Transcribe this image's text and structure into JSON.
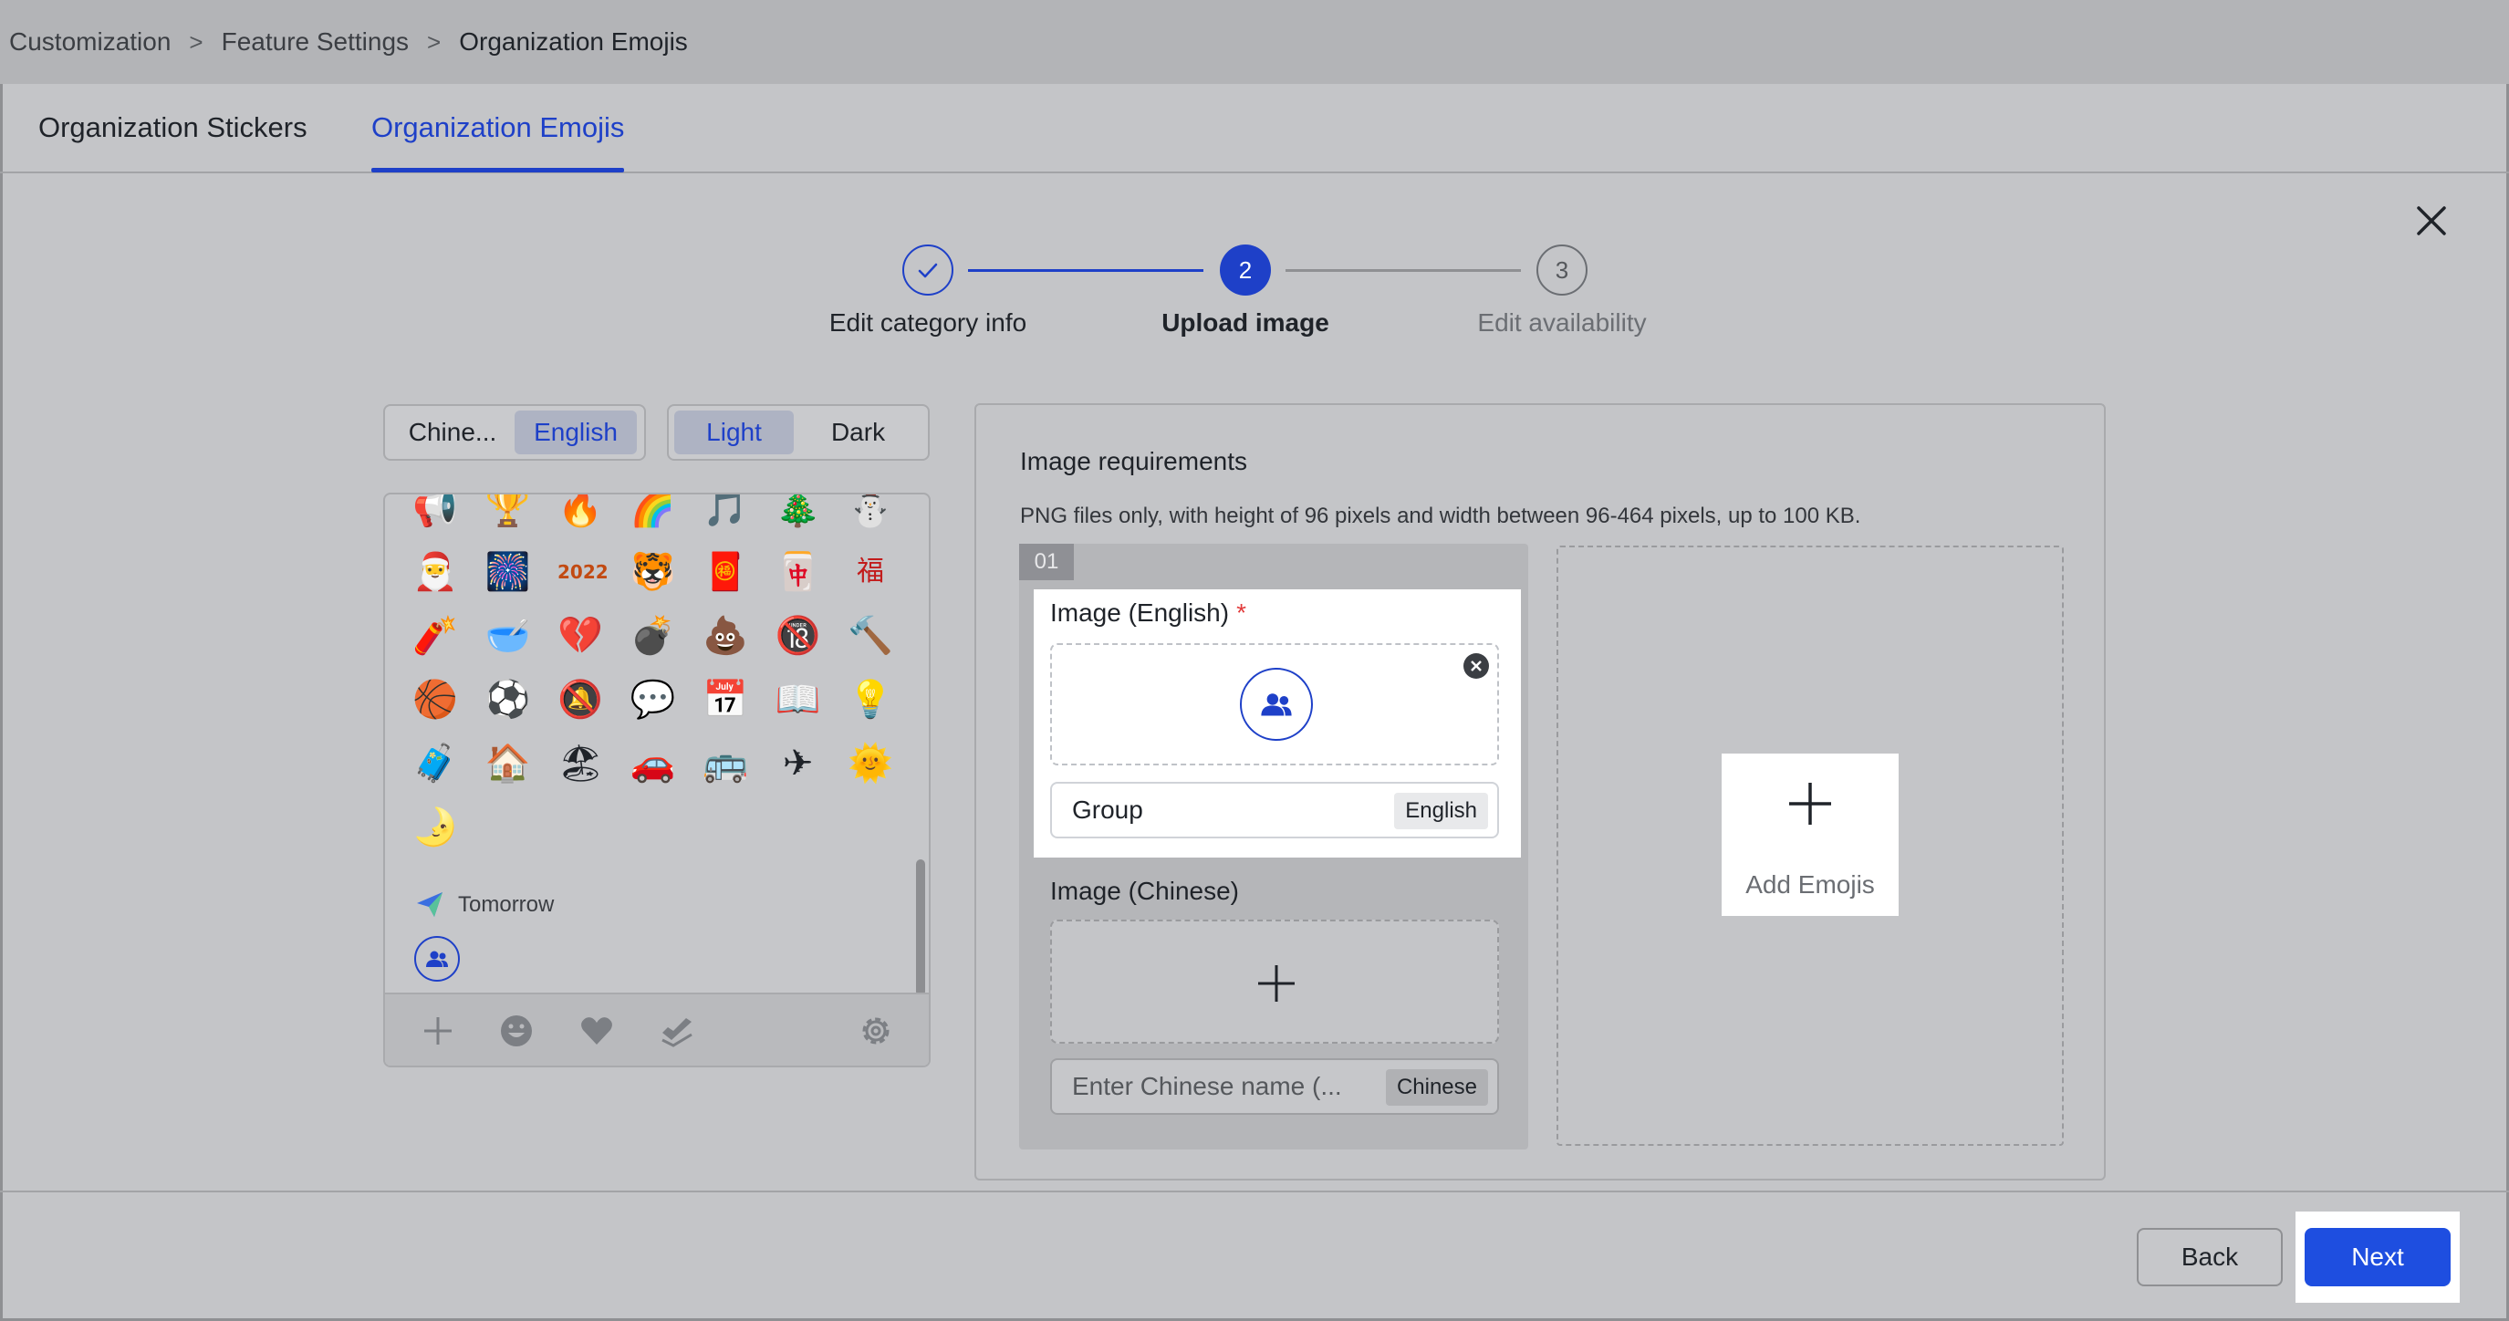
{
  "breadcrumb": {
    "items": [
      "Customization",
      "Feature Settings",
      "Organization Emojis"
    ],
    "separator": ">"
  },
  "tabs": [
    {
      "label": "Organization Stickers",
      "active": false
    },
    {
      "label": "Organization Emojis",
      "active": true
    }
  ],
  "stepper": {
    "steps": [
      {
        "number": "",
        "label": "Edit category info",
        "state": "done"
      },
      {
        "number": "2",
        "label": "Upload image",
        "state": "current"
      },
      {
        "number": "3",
        "label": "Edit availability",
        "state": "pending"
      }
    ]
  },
  "language_toggle": {
    "options": [
      "Chine...",
      "English"
    ],
    "selected": "English"
  },
  "theme_toggle": {
    "options": [
      "Light",
      "Dark"
    ],
    "selected": "Light"
  },
  "emoji_panel": {
    "rows": [
      [
        "📢",
        "🏆",
        "🔥",
        "🌈",
        "🎵",
        "🎄",
        "⛄"
      ],
      [
        "🎅",
        "🎆",
        "2022",
        "🐯",
        "🧧",
        "🀄",
        "福"
      ],
      [
        "🧨",
        "🥣",
        "💔",
        "💣",
        "💩",
        "🔞",
        "🔨"
      ],
      [
        "🏀",
        "⚽",
        "🔕",
        "💬",
        "📅",
        "📖",
        "💡"
      ],
      [
        "🧳",
        "🏠",
        "🏖",
        "🚗",
        "🚌",
        "✈",
        "🌞"
      ],
      [
        "🌛"
      ]
    ],
    "section_label": "Tomorrow",
    "footer_icons": [
      "plus-icon",
      "smile-icon",
      "heart-icon",
      "hand-icon",
      "gear-icon"
    ]
  },
  "requirements": {
    "title": "Image requirements",
    "description": "PNG files only, with height of 96 pixels and width between 96-464 pixels, up to 100 KB."
  },
  "emoji_item": {
    "index": "01",
    "english": {
      "label": "Image (English)",
      "required_mark": "*",
      "name_value": "Group",
      "lang_tag": "English"
    },
    "chinese": {
      "label": "Image (Chinese)",
      "name_placeholder": "Enter Chinese name (...",
      "lang_tag": "Chinese"
    }
  },
  "add_emojis": {
    "label": "Add Emojis"
  },
  "actions": {
    "back": "Back",
    "next": "Next"
  },
  "colors": {
    "accent": "#1e40c8",
    "primary_button": "#1e4ee0",
    "required": "#e23b3b"
  }
}
